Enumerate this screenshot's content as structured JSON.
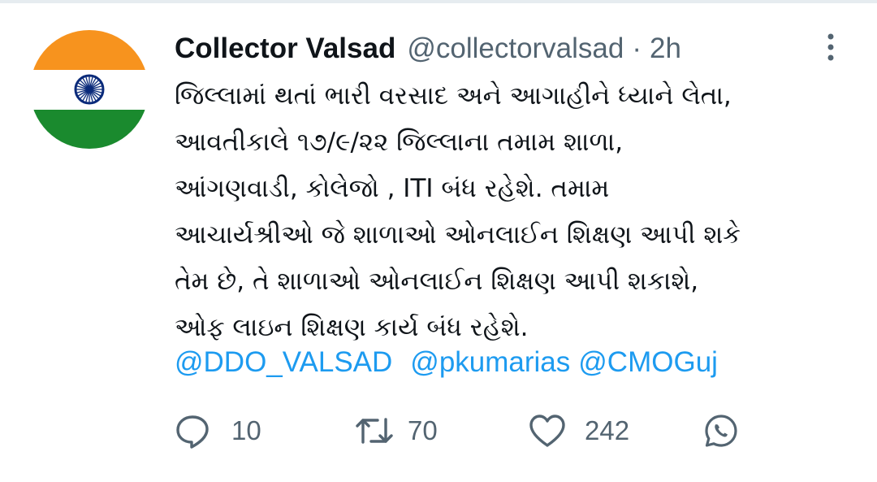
{
  "tweet": {
    "author_name": "Collector Valsad",
    "handle": "@collectorvalsad",
    "separator": "·",
    "time": "2h",
    "text_lines": [
      "જિલ્લામાં થતાં ભારી વરસાદ અને આગાહીને ધ્યાને લેતા,",
      "આવતીકાલે ૧૭/૯/૨૨ જિલ્લાના તમામ શાળા,",
      "આંગણવાડી, કોલેજો , ITI બંધ રહેશે. તમામ",
      "આચાર્યશ્રીઓ જે શાળાઓ ઓનલાઈન શિક્ષણ આપી શકે",
      "તેમ છે, તે શાળાઓ ઓનલાઈન શિક્ષણ આપી શકાશે,",
      "ઓફ લાઇન શિક્ષણ કાર્ય બંધ રહેશે."
    ],
    "mentions": [
      "@DDO_VALSAD",
      "@pkumarias",
      "@CMOGuj"
    ]
  },
  "actions": {
    "reply_count": "10",
    "retweet_count": "70",
    "like_count": "242"
  },
  "icons": {
    "avatar": "india-flag",
    "more": "vertical-dots-icon",
    "reply": "speech-bubble-icon",
    "retweet": "retweet-arrows-icon",
    "like": "heart-icon",
    "share": "whatsapp-icon"
  },
  "colors": {
    "text": "#0f1419",
    "secondary": "#536471",
    "link": "#1d9bf0",
    "flag_saffron": "#ff9933",
    "flag_white": "#ffffff",
    "flag_green": "#138808",
    "chakra": "#000080"
  }
}
